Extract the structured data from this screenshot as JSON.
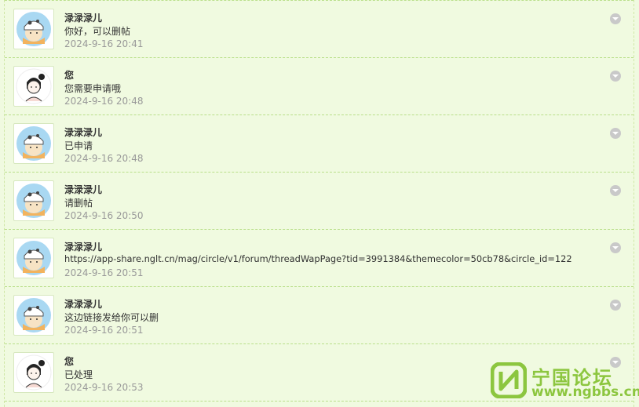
{
  "messages": [
    {
      "sender": "渌渌渌儿",
      "content": "你好，可以删帖",
      "time": "2024-9-16 20:41",
      "avatar": "cow-girl"
    },
    {
      "sender": "您",
      "content": "您需要申请哦",
      "time": "2024-9-16 20:48",
      "avatar": "sketch-girl"
    },
    {
      "sender": "渌渌渌儿",
      "content": "已申请",
      "time": "2024-9-16 20:48",
      "avatar": "cow-girl"
    },
    {
      "sender": "渌渌渌儿",
      "content": "请删帖",
      "time": "2024-9-16 20:50",
      "avatar": "cow-girl"
    },
    {
      "sender": "渌渌渌儿",
      "content": "https://app-share.nglt.cn/mag/circle/v1/forum/threadWapPage?tid=3991384&themecolor=50cb78&circle_id=122",
      "time": "2024-9-16 20:51",
      "avatar": "cow-girl"
    },
    {
      "sender": "渌渌渌儿",
      "content": "这边链接发给你可以删",
      "time": "2024-9-16 20:51",
      "avatar": "cow-girl"
    },
    {
      "sender": "您",
      "content": "已处理",
      "time": "2024-9-16 20:53",
      "avatar": "sketch-girl"
    }
  ],
  "watermark": {
    "title": "宁国论坛",
    "url": "www.ngbbs.cn",
    "color": "#8cc63f"
  },
  "icons": {
    "menu": "chevron-down-circle-icon"
  }
}
